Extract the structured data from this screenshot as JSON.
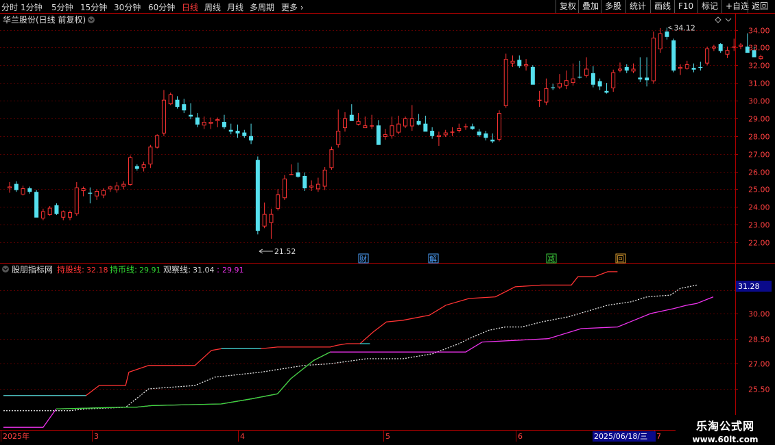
{
  "toolbar": {
    "left": [
      {
        "label": "分时",
        "active": false
      },
      {
        "label": "1分钟",
        "active": false
      },
      {
        "label": "5分钟",
        "active": false
      },
      {
        "label": "15分钟",
        "active": false
      },
      {
        "label": "30分钟",
        "active": false
      },
      {
        "label": "60分钟",
        "active": false
      },
      {
        "label": "日线",
        "active": true
      },
      {
        "label": "周线",
        "active": false
      },
      {
        "label": "月线",
        "active": false
      },
      {
        "label": "多周期",
        "active": false
      },
      {
        "label": "更多",
        "active": false
      }
    ],
    "right": [
      "复权",
      "叠加",
      "多股",
      "统计",
      "画线",
      "F10",
      "标记",
      "+自选",
      "返回"
    ]
  },
  "main_chart": {
    "title": "华兰股份(日线 前复权)",
    "high_marker": "34.12",
    "low_marker": "21.52",
    "y_ticks": [
      "34.00",
      "33.00",
      "32.00",
      "31.00",
      "30.00",
      "29.00",
      "28.00",
      "27.00",
      "26.00",
      "25.00",
      "24.00",
      "23.00",
      "22.00"
    ],
    "events": [
      {
        "label": "财",
        "color": "#4fa3ff"
      },
      {
        "label": "解",
        "color": "#4fa3ff"
      },
      {
        "label": "减",
        "color": "#3ecf3e"
      },
      {
        "label": "回",
        "color": "#e0a030"
      }
    ]
  },
  "indicator": {
    "name": "股朋指标网",
    "items": [
      {
        "label": "持股线:",
        "value": "32.18",
        "color": "#ff3333"
      },
      {
        "label": "持币线:",
        "value": "29.91",
        "color": "#33dd33"
      },
      {
        "label": "观察线:",
        "value": "31.04",
        "color": "#dddddd"
      },
      {
        "label": ":",
        "value": "29.91",
        "color": "#ee33ee"
      }
    ],
    "y_ticks": [
      "30.00",
      "28.50",
      "27.00",
      "25.50"
    ],
    "current_label": "31.28"
  },
  "x_axis": {
    "labels": [
      "2025年",
      "3",
      "4",
      "5",
      "6",
      "7"
    ],
    "cursor_date": "2025/06/18/三"
  },
  "brand": {
    "line1": "乐淘公式网",
    "line2": "www.60lt.com"
  },
  "colors": {
    "up": "#ff3333",
    "down": "#55e0ee",
    "grid": "#5a0000",
    "axis": "#aa0000",
    "purple": "#ee33ee",
    "green": "#33dd33",
    "cyan": "#33cccc"
  },
  "chart_data": {
    "type": "candlestick",
    "candles": [
      [
        25.05,
        25.4,
        24.8,
        25.15
      ],
      [
        25.3,
        25.45,
        24.85,
        24.95
      ],
      [
        24.7,
        25.2,
        24.65,
        25.05
      ],
      [
        25.05,
        25.15,
        24.75,
        24.85
      ],
      [
        24.85,
        24.95,
        23.95,
        23.4
      ],
      [
        23.35,
        23.9,
        23.25,
        23.75
      ],
      [
        23.55,
        24.05,
        23.5,
        23.95
      ],
      [
        24.1,
        24.2,
        23.55,
        23.6
      ],
      [
        23.4,
        23.8,
        23.25,
        23.75
      ],
      [
        23.4,
        23.8,
        23.25,
        23.7
      ],
      [
        23.6,
        25.4,
        23.5,
        25.1
      ],
      [
        24.9,
        25.15,
        24.6,
        25.05
      ],
      [
        24.8,
        25.1,
        24.2,
        24.75
      ],
      [
        24.6,
        25.0,
        24.4,
        24.9
      ],
      [
        24.65,
        25.05,
        24.5,
        24.95
      ],
      [
        25.0,
        25.2,
        24.85,
        25.15
      ],
      [
        24.95,
        25.4,
        24.8,
        25.2
      ],
      [
        25.15,
        25.45,
        25.0,
        25.3
      ],
      [
        25.25,
        26.9,
        25.2,
        26.8
      ],
      [
        26.3,
        26.4,
        26.05,
        26.15
      ],
      [
        26.2,
        26.55,
        26.0,
        26.4
      ],
      [
        26.4,
        27.5,
        26.2,
        27.4
      ],
      [
        27.35,
        28.1,
        27.3,
        28.05
      ],
      [
        28.15,
        30.6,
        28.0,
        30.05
      ],
      [
        29.8,
        30.45,
        29.75,
        30.35
      ],
      [
        30.05,
        30.25,
        29.55,
        29.65
      ],
      [
        29.8,
        30.1,
        29.3,
        29.45
      ],
      [
        29.2,
        29.85,
        28.95,
        29.1
      ],
      [
        29.05,
        29.3,
        28.5,
        28.65
      ],
      [
        28.6,
        29.1,
        28.4,
        28.8
      ],
      [
        28.7,
        29.05,
        28.4,
        28.8
      ],
      [
        28.85,
        29.05,
        28.5,
        28.95
      ],
      [
        28.8,
        29.2,
        28.4,
        28.5
      ],
      [
        28.35,
        28.7,
        28.1,
        28.25
      ],
      [
        28.3,
        28.65,
        27.9,
        28.15
      ],
      [
        28.2,
        28.35,
        27.9,
        28.0
      ],
      [
        28.0,
        28.7,
        27.55,
        27.75
      ],
      [
        26.65,
        26.85,
        22.45,
        22.65
      ],
      [
        22.9,
        24.25,
        22.8,
        23.6
      ],
      [
        23.1,
        23.9,
        22.2,
        23.6
      ],
      [
        23.9,
        25.0,
        23.8,
        24.7
      ],
      [
        24.5,
        25.8,
        24.4,
        25.6
      ],
      [
        25.8,
        26.4,
        25.8,
        25.85
      ],
      [
        25.95,
        26.5,
        25.65,
        25.7
      ],
      [
        25.75,
        25.95,
        24.9,
        25.05
      ],
      [
        25.1,
        25.5,
        24.9,
        25.2
      ],
      [
        25.0,
        25.65,
        24.85,
        25.3
      ],
      [
        25.15,
        26.25,
        24.95,
        26.1
      ],
      [
        26.2,
        27.4,
        26.1,
        27.25
      ],
      [
        27.5,
        29.5,
        27.35,
        28.3
      ],
      [
        28.45,
        29.35,
        28.25,
        29.0
      ],
      [
        29.2,
        29.8,
        28.95,
        28.85
      ],
      [
        28.65,
        29.3,
        28.6,
        28.85
      ],
      [
        28.45,
        29.1,
        28.5,
        28.6
      ],
      [
        28.6,
        29.2,
        28.4,
        28.6
      ],
      [
        28.6,
        28.9,
        27.75,
        27.5
      ],
      [
        27.95,
        28.4,
        27.8,
        28.1
      ],
      [
        28.0,
        29.1,
        27.85,
        28.6
      ],
      [
        28.2,
        29.15,
        28.1,
        28.7
      ],
      [
        28.55,
        29.1,
        28.45,
        29.0
      ],
      [
        28.55,
        29.75,
        28.3,
        29.0
      ],
      [
        28.85,
        29.25,
        28.6,
        28.65
      ],
      [
        28.7,
        29.15,
        28.4,
        28.25
      ],
      [
        28.3,
        28.5,
        27.85,
        28.0
      ],
      [
        27.95,
        28.25,
        27.45,
        28.05
      ],
      [
        28.05,
        28.35,
        27.95,
        28.2
      ],
      [
        28.2,
        28.5,
        28.0,
        28.25
      ],
      [
        28.3,
        28.7,
        28.2,
        28.45
      ],
      [
        28.5,
        28.7,
        28.35,
        28.55
      ],
      [
        28.55,
        28.7,
        28.35,
        28.4
      ],
      [
        28.25,
        28.4,
        27.95,
        28.05
      ],
      [
        28.15,
        28.3,
        27.75,
        27.9
      ],
      [
        27.8,
        28.15,
        27.6,
        27.7
      ],
      [
        27.8,
        29.45,
        27.7,
        29.3
      ],
      [
        29.7,
        32.65,
        29.6,
        32.35
      ],
      [
        32.1,
        32.55,
        31.9,
        32.25
      ],
      [
        32.3,
        32.55,
        31.85,
        31.95
      ],
      [
        31.95,
        32.35,
        31.7,
        32.05
      ],
      [
        31.9,
        32.0,
        31.8,
        30.9
      ],
      [
        30.0,
        30.55,
        29.65,
        30.05
      ],
      [
        29.9,
        31.25,
        29.75,
        30.7
      ],
      [
        30.75,
        30.95,
        30.6,
        30.7
      ],
      [
        30.75,
        31.5,
        30.65,
        31.0
      ],
      [
        30.85,
        31.7,
        30.65,
        31.15
      ],
      [
        31.0,
        32.1,
        30.85,
        31.25
      ],
      [
        31.35,
        32.25,
        31.25,
        31.3
      ],
      [
        31.4,
        32.45,
        31.3,
        31.8
      ],
      [
        31.55,
        31.95,
        30.75,
        30.9
      ],
      [
        31.1,
        31.25,
        30.6,
        30.8
      ],
      [
        30.55,
        31.0,
        30.4,
        30.45
      ],
      [
        30.7,
        31.75,
        30.5,
        31.6
      ],
      [
        31.7,
        32.15,
        31.6,
        31.8
      ],
      [
        31.9,
        32.05,
        31.55,
        31.7
      ],
      [
        31.65,
        32.1,
        31.55,
        31.8
      ],
      [
        31.3,
        32.45,
        31.05,
        31.2
      ],
      [
        31.3,
        32.45,
        30.8,
        31.15
      ],
      [
        31.1,
        33.9,
        30.95,
        33.55
      ],
      [
        32.9,
        34.1,
        32.7,
        33.8
      ],
      [
        33.9,
        34.12,
        33.45,
        33.6
      ],
      [
        33.4,
        33.5,
        31.6,
        31.7
      ],
      [
        31.8,
        32.05,
        31.45,
        31.9
      ],
      [
        31.8,
        32.25,
        31.75,
        32.05
      ],
      [
        31.85,
        32.1,
        31.6,
        31.75
      ],
      [
        31.9,
        32.2,
        31.7,
        31.85
      ],
      [
        32.1,
        33.05,
        32.0,
        32.95
      ],
      [
        32.95,
        33.15,
        32.8,
        33.05
      ],
      [
        33.2,
        33.25,
        32.7,
        32.8
      ],
      [
        32.6,
        33.05,
        32.4,
        32.85
      ],
      [
        33.0,
        33.5,
        32.8,
        33.05
      ],
      [
        33.05,
        33.25,
        32.9,
        33.15
      ],
      [
        33.05,
        33.8,
        32.9,
        32.7
      ],
      [
        32.85,
        33.05,
        32.5,
        32.45
      ],
      [
        32.35,
        32.6,
        32.3,
        32.5
      ]
    ],
    "hold_line": [
      [
        0,
        25.1
      ],
      [
        25,
        25.1
      ],
      [
        29,
        25.7
      ],
      [
        37,
        25.7
      ],
      [
        38,
        26.5
      ],
      [
        44,
        26.9
      ],
      [
        58,
        26.9
      ],
      [
        63,
        27.8
      ],
      [
        66,
        27.9
      ],
      [
        78,
        27.9
      ],
      [
        83,
        28.0
      ],
      [
        99,
        28.0
      ],
      [
        101,
        28.1
      ],
      [
        104,
        28.2
      ],
      [
        108,
        28.2
      ],
      [
        112,
        28.9
      ],
      [
        116,
        29.5
      ],
      [
        121,
        29.6
      ],
      [
        129,
        29.9
      ],
      [
        134,
        30.5
      ],
      [
        141,
        30.9
      ],
      [
        149,
        31.0
      ],
      [
        155,
        31.6
      ],
      [
        163,
        31.7
      ],
      [
        172,
        31.7
      ],
      [
        174,
        32.2
      ],
      [
        179,
        32.2
      ],
      [
        183,
        32.5
      ],
      [
        186,
        32.5
      ]
    ],
    "watch_line": [
      [
        0,
        24.2
      ],
      [
        20,
        24.2
      ],
      [
        25,
        24.3
      ],
      [
        37,
        24.4
      ],
      [
        44,
        25.5
      ],
      [
        58,
        25.7
      ],
      [
        64,
        26.2
      ],
      [
        78,
        26.5
      ],
      [
        91,
        26.9
      ],
      [
        99,
        27.0
      ],
      [
        110,
        27.3
      ],
      [
        121,
        27.3
      ],
      [
        130,
        27.6
      ],
      [
        138,
        28.2
      ],
      [
        141,
        28.5
      ],
      [
        147,
        29.0
      ],
      [
        152,
        29.2
      ],
      [
        157,
        29.2
      ],
      [
        163,
        29.5
      ],
      [
        171,
        29.8
      ],
      [
        183,
        30.5
      ],
      [
        190,
        30.7
      ],
      [
        195,
        31.0
      ],
      [
        202,
        31.1
      ],
      [
        205,
        31.5
      ],
      [
        210,
        31.7
      ]
    ],
    "money_line": [
      [
        0,
        23.2
      ],
      [
        12,
        23.2
      ],
      [
        16,
        24.3
      ],
      [
        36,
        24.4
      ],
      [
        40,
        24.4
      ],
      [
        45,
        24.5
      ],
      [
        66,
        24.6
      ],
      [
        75,
        24.9
      ],
      [
        83,
        25.2
      ],
      [
        87,
        26.1
      ],
      [
        94,
        27.2
      ],
      [
        99,
        27.7
      ],
      [
        140,
        27.7
      ],
      [
        145,
        28.3
      ],
      [
        165,
        28.5
      ],
      [
        175,
        29.1
      ],
      [
        186,
        29.2
      ],
      [
        191,
        29.6
      ],
      [
        196,
        30.0
      ],
      [
        203,
        30.3
      ],
      [
        207,
        30.5
      ],
      [
        210,
        30.6
      ],
      [
        215,
        31.0
      ]
    ]
  }
}
